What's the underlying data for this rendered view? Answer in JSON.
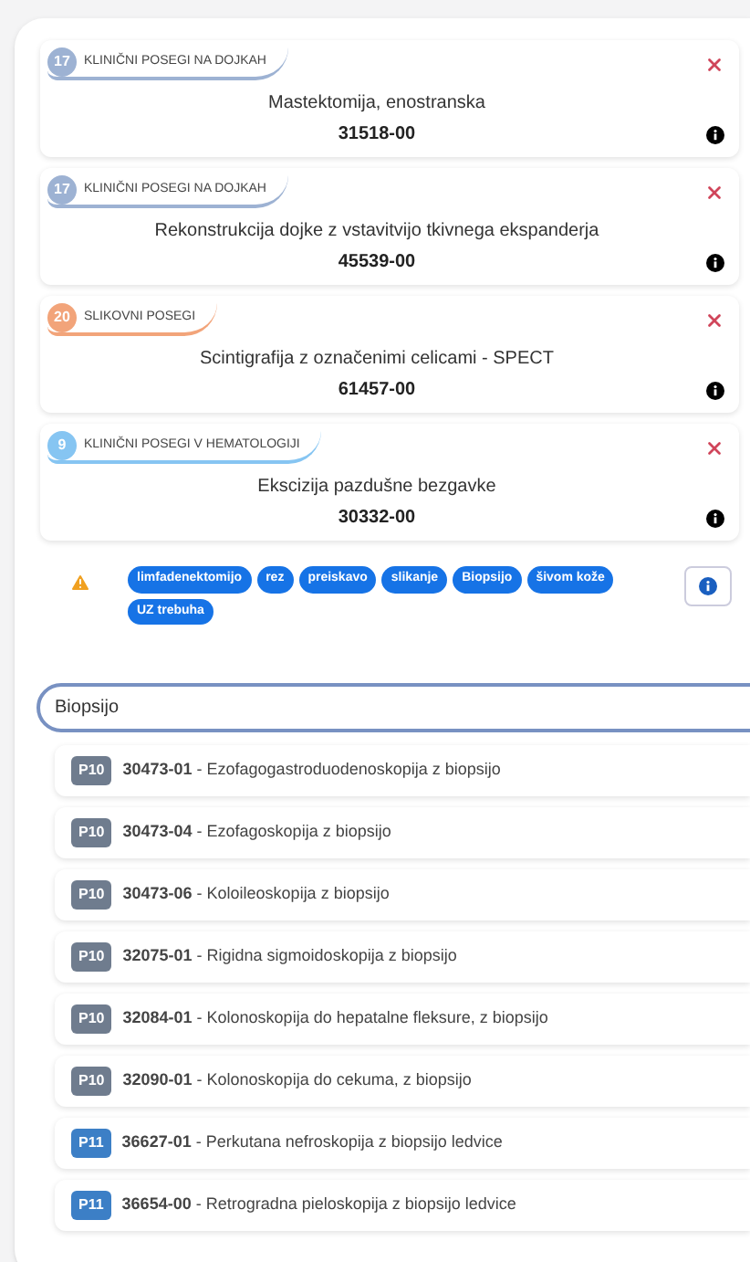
{
  "procedures": [
    {
      "category_number": "17",
      "category": "KLINIČNI POSEGI NA DOJKAH",
      "color": "#9db2d3",
      "title": "Mastektomija, enostranska",
      "code": "31518-00"
    },
    {
      "category_number": "17",
      "category": "KLINIČNI POSEGI NA DOJKAH",
      "color": "#9db2d3",
      "title": "Rekonstrukcija dojke z vstavitvijo tkivnega ekspanderja",
      "code": "45539-00"
    },
    {
      "category_number": "20",
      "category": "SLIKOVNI POSEGI",
      "color": "#f2a47a",
      "title": "Scintigrafija z označenimi celicami - SPECT",
      "code": "61457-00"
    },
    {
      "category_number": "9",
      "category": "KLINIČNI POSEGI V HEMATOLOGIJI",
      "color": "#86c5f2",
      "title": "Ekscizija pazdušne bezgavke",
      "code": "30332-00"
    }
  ],
  "keywords": [
    "limfadenektomijo",
    "rez",
    "preiskavo",
    "slikanje",
    "Biopsijo",
    "šivom kože",
    "UZ trebuha"
  ],
  "search": {
    "value": "Biopsijo"
  },
  "results": [
    {
      "group": "P10",
      "color": "#6f7c8e",
      "text": "**30473-01** - Ezofagogastroduodenoskopija z biopsijo"
    },
    {
      "group": "P10",
      "color": "#6f7c8e",
      "text": "**30473-04** - Ezofagoskopija z biopsijo"
    },
    {
      "group": "P10",
      "color": "#6f7c8e",
      "text": "**30473-06** - Koloileoskopija z biopsijo"
    },
    {
      "group": "P10",
      "color": "#6f7c8e",
      "text": "**32075-01** - Rigidna sigmoidoskopija z biopsijo"
    },
    {
      "group": "P10",
      "color": "#6f7c8e",
      "text": "**32084-01** - Kolonoskopija do hepatalne fleksure, z biopsijo"
    },
    {
      "group": "P10",
      "color": "#6f7c8e",
      "text": "**32090-01** - Kolonoskopija do cekuma, z biopsijo"
    },
    {
      "group": "P11",
      "color": "#3c7fc6",
      "text": "**36627-01** - Perkutana nefroskopija z biopsijo ledvice"
    },
    {
      "group": "P11",
      "color": "#3c7fc6",
      "text": "**36654-00** - Retrogradna pieloskopija z biopsijo ledvice"
    }
  ]
}
